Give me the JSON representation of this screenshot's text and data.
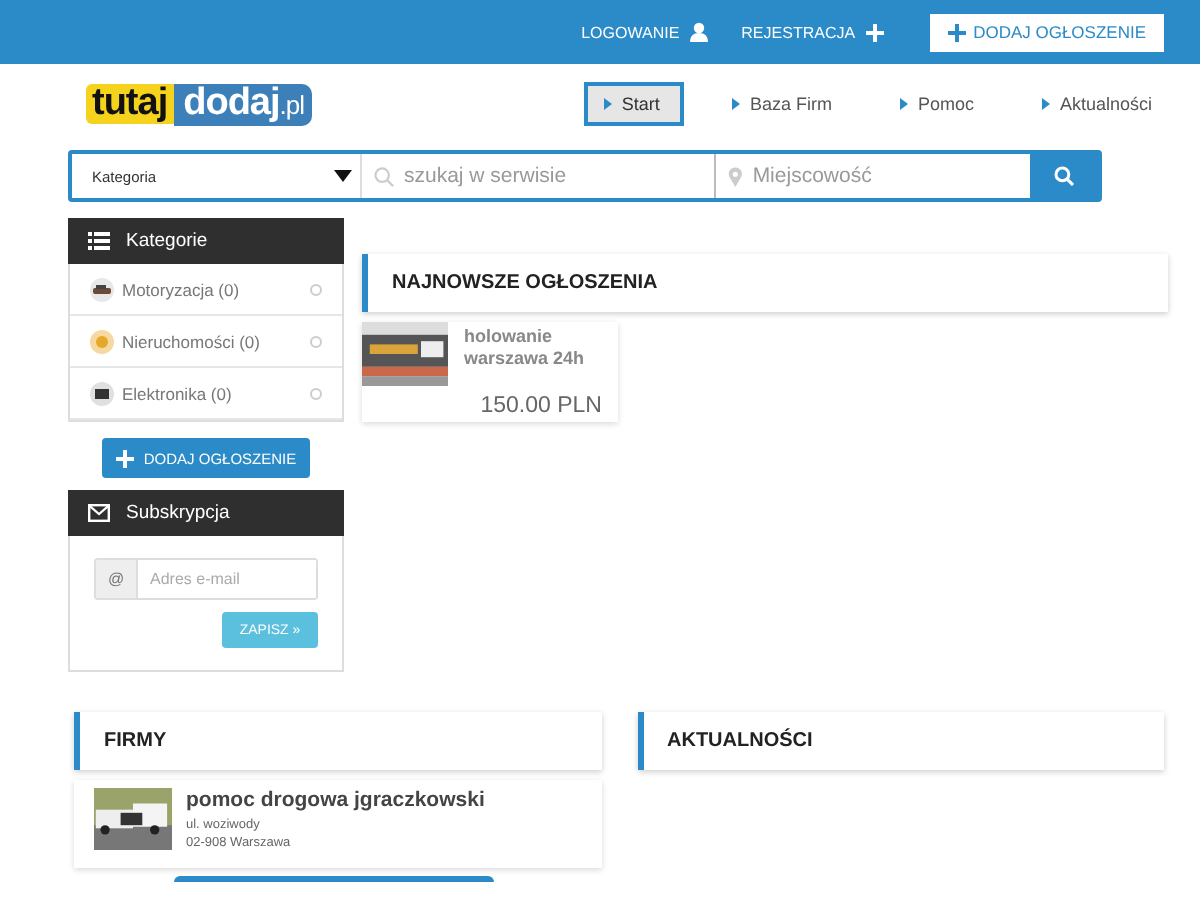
{
  "top_bar": {
    "links": [
      {
        "label": "LOGOWANIE",
        "kind": "user"
      },
      {
        "label": "REJESTRACJA",
        "kind": "plus"
      }
    ],
    "add_button": "DODAJ OGŁOSZENIE"
  },
  "logo": {
    "part_1": "tutaj",
    "part_2": "dodaj",
    "part_3": ".pl"
  },
  "nav": [
    {
      "label": "Start",
      "selected": true
    },
    {
      "label": "Baza Firm",
      "selected": false
    },
    {
      "label": "Pomoc",
      "selected": false
    },
    {
      "label": "Aktualności",
      "selected": false
    }
  ],
  "search": {
    "category": "Kategoria",
    "query_placeholder": "szukaj w serwisie",
    "location_placeholder": "Miejscowość"
  },
  "sidebar": {
    "categories_title": "Kategorie",
    "categories": [
      {
        "label": "Motoryzacja (0)",
        "kind": "car"
      },
      {
        "label": "Nieruchomości (0)",
        "kind": "house"
      },
      {
        "label": "Elektronika (0)",
        "kind": "tv"
      }
    ],
    "add_button": "DODAJ OGŁOSZENIE",
    "subscription_title": "Subskrypcja",
    "email_prefix": "@",
    "email_placeholder": "Adres e-mail",
    "save_button": "ZAPISZ »"
  },
  "latest": {
    "title": "NAJNOWSZE OGŁOSZENIA",
    "ads": [
      {
        "title": "holowanie warszawa 24h",
        "price": "150.00 PLN",
        "kind": "picture"
      }
    ]
  },
  "firms": {
    "title": "FIRMY",
    "items": [
      {
        "name": "pomoc drogowa jgraczkowski",
        "street": "ul. woziwody",
        "city": "02-908 Warszawa",
        "kind": "picture"
      }
    ]
  },
  "news": {
    "title": "AKTUALNOŚCI"
  }
}
